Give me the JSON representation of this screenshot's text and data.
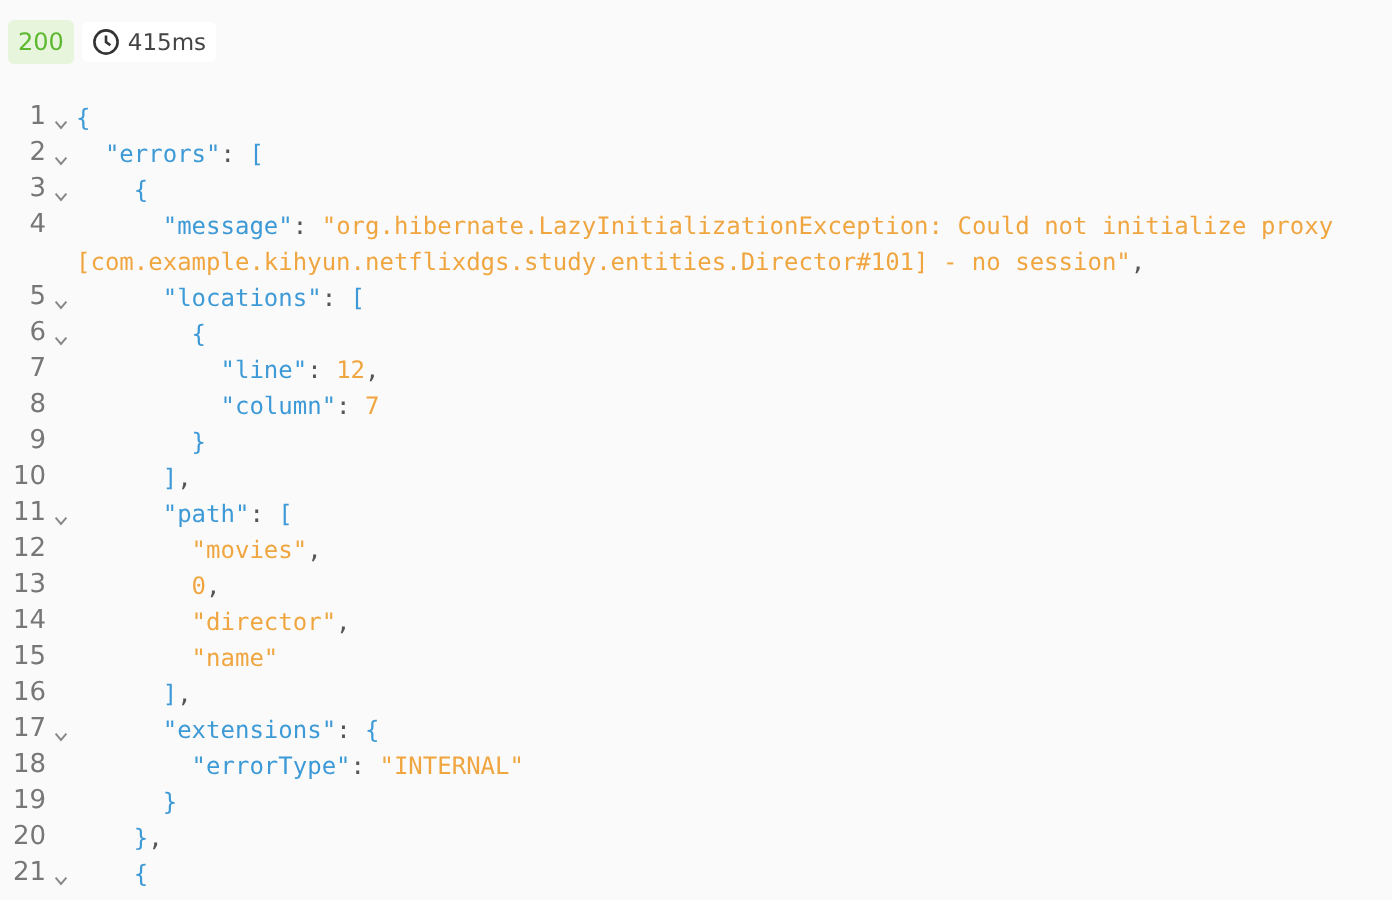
{
  "status": {
    "code": "200",
    "time": "415ms"
  },
  "lines": [
    {
      "n": "1",
      "fold": true,
      "tokens": [
        {
          "kind": "punct",
          "text": "{"
        }
      ]
    },
    {
      "n": "2",
      "fold": true,
      "tokens": [
        {
          "kind": "key",
          "text": "  \"errors\""
        },
        {
          "kind": "colon",
          "text": ": "
        },
        {
          "kind": "punct",
          "text": "["
        }
      ]
    },
    {
      "n": "3",
      "fold": true,
      "tokens": [
        {
          "kind": "punct",
          "text": "    {"
        }
      ]
    },
    {
      "n": "4",
      "fold": false,
      "tokens": [
        {
          "kind": "key",
          "text": "      \"message\""
        },
        {
          "kind": "colon",
          "text": ": "
        },
        {
          "kind": "value",
          "text": "\"org.hibernate.LazyInitializationException: Could not initialize proxy [com.example.kihyun.netflixdgs.study.entities.Director#101] - no session\""
        },
        {
          "kind": "colon",
          "text": ","
        }
      ]
    },
    {
      "n": "5",
      "fold": true,
      "tokens": [
        {
          "kind": "key",
          "text": "      \"locations\""
        },
        {
          "kind": "colon",
          "text": ": "
        },
        {
          "kind": "punct",
          "text": "["
        }
      ]
    },
    {
      "n": "6",
      "fold": true,
      "tokens": [
        {
          "kind": "punct",
          "text": "        {"
        }
      ]
    },
    {
      "n": "7",
      "fold": false,
      "tokens": [
        {
          "kind": "key",
          "text": "          \"line\""
        },
        {
          "kind": "colon",
          "text": ": "
        },
        {
          "kind": "value",
          "text": "12"
        },
        {
          "kind": "colon",
          "text": ","
        }
      ]
    },
    {
      "n": "8",
      "fold": false,
      "tokens": [
        {
          "kind": "key",
          "text": "          \"column\""
        },
        {
          "kind": "colon",
          "text": ": "
        },
        {
          "kind": "value",
          "text": "7"
        }
      ]
    },
    {
      "n": "9",
      "fold": false,
      "tokens": [
        {
          "kind": "punct",
          "text": "        }"
        }
      ]
    },
    {
      "n": "10",
      "fold": false,
      "tokens": [
        {
          "kind": "punct",
          "text": "      ]"
        },
        {
          "kind": "colon",
          "text": ","
        }
      ]
    },
    {
      "n": "11",
      "fold": true,
      "tokens": [
        {
          "kind": "key",
          "text": "      \"path\""
        },
        {
          "kind": "colon",
          "text": ": "
        },
        {
          "kind": "punct",
          "text": "["
        }
      ]
    },
    {
      "n": "12",
      "fold": false,
      "tokens": [
        {
          "kind": "value",
          "text": "        \"movies\""
        },
        {
          "kind": "colon",
          "text": ","
        }
      ]
    },
    {
      "n": "13",
      "fold": false,
      "tokens": [
        {
          "kind": "value",
          "text": "        0"
        },
        {
          "kind": "colon",
          "text": ","
        }
      ]
    },
    {
      "n": "14",
      "fold": false,
      "tokens": [
        {
          "kind": "value",
          "text": "        \"director\""
        },
        {
          "kind": "colon",
          "text": ","
        }
      ]
    },
    {
      "n": "15",
      "fold": false,
      "tokens": [
        {
          "kind": "value",
          "text": "        \"name\""
        }
      ]
    },
    {
      "n": "16",
      "fold": false,
      "tokens": [
        {
          "kind": "punct",
          "text": "      ]"
        },
        {
          "kind": "colon",
          "text": ","
        }
      ]
    },
    {
      "n": "17",
      "fold": true,
      "tokens": [
        {
          "kind": "key",
          "text": "      \"extensions\""
        },
        {
          "kind": "colon",
          "text": ": "
        },
        {
          "kind": "punct",
          "text": "{"
        }
      ]
    },
    {
      "n": "18",
      "fold": false,
      "tokens": [
        {
          "kind": "key",
          "text": "        \"errorType\""
        },
        {
          "kind": "colon",
          "text": ": "
        },
        {
          "kind": "value",
          "text": "\"INTERNAL\""
        }
      ]
    },
    {
      "n": "19",
      "fold": false,
      "tokens": [
        {
          "kind": "punct",
          "text": "      }"
        }
      ]
    },
    {
      "n": "20",
      "fold": false,
      "tokens": [
        {
          "kind": "punct",
          "text": "    }"
        },
        {
          "kind": "colon",
          "text": ","
        }
      ]
    },
    {
      "n": "21",
      "fold": true,
      "tokens": [
        {
          "kind": "punct",
          "text": "    {"
        }
      ]
    }
  ]
}
